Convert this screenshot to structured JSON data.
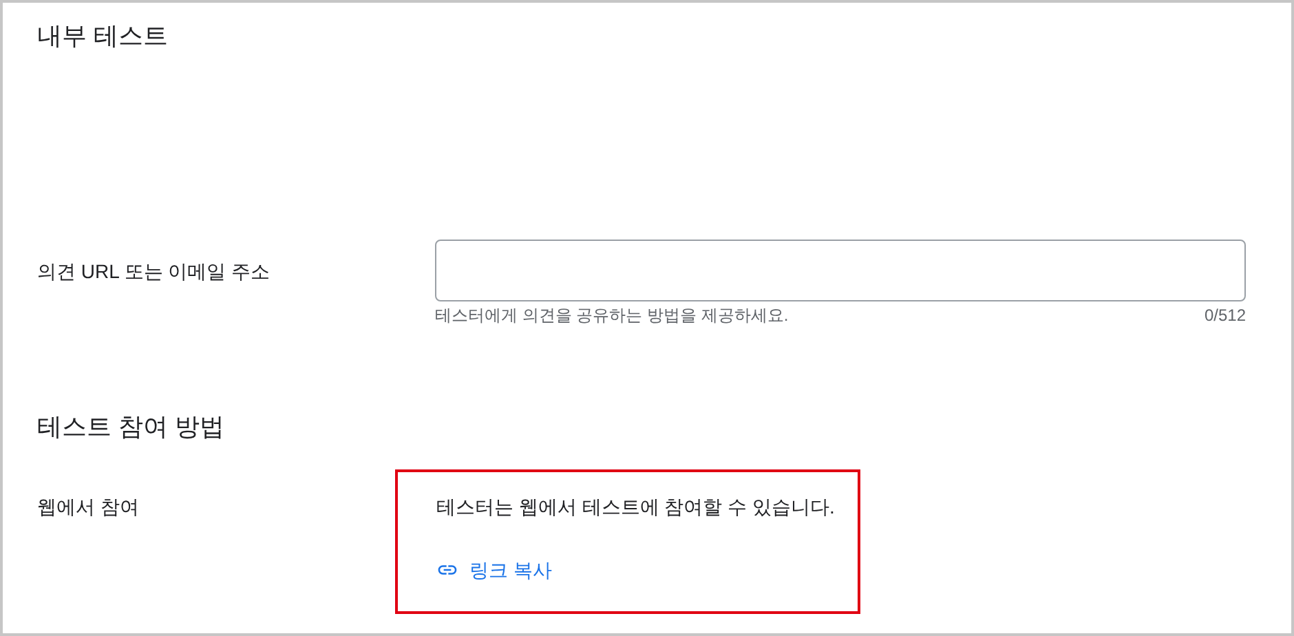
{
  "title": "내부 테스트",
  "feedback": {
    "label": "의견 URL 또는 이메일 주소",
    "helper": "테스터에게 의견을 공유하는 방법을 제공하세요.",
    "counter": "0/512"
  },
  "join_section": {
    "title": "테스트 참여 방법",
    "label": "웹에서 참여",
    "description": "테스터는 웹에서 테스트에 참여할 수 있습니다.",
    "link": "링크 복사",
    "highlighted": true
  }
}
